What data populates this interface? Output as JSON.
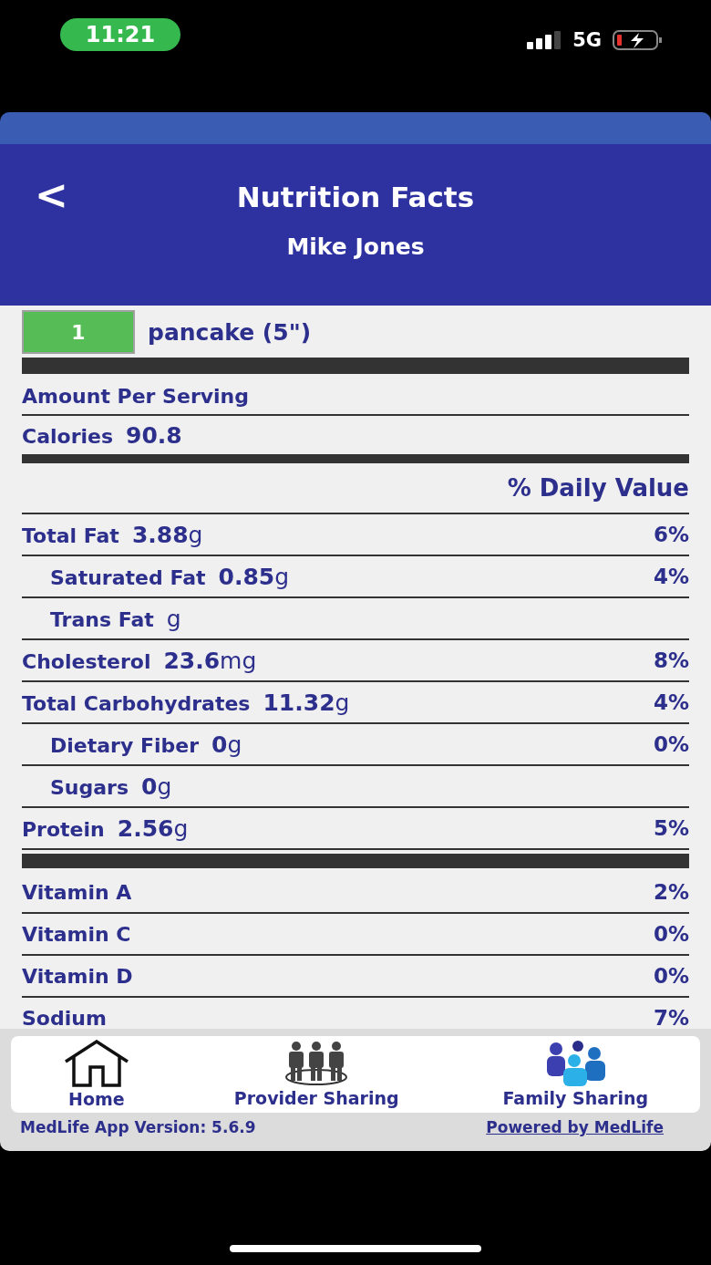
{
  "status_bar": {
    "time": "11:21",
    "network": "5G"
  },
  "header": {
    "back": "<",
    "title": "Nutrition Facts",
    "subtitle": "Mike Jones"
  },
  "serving": {
    "quantity": "1",
    "unit": "pancake (5\")"
  },
  "amount_label": "Amount Per Serving",
  "calories": {
    "label": "Calories",
    "value": "90.8"
  },
  "daily_value_header": "% Daily Value",
  "nutrients": [
    {
      "name": "Total Fat",
      "value": "3.88",
      "unit": "g",
      "percent": "6%",
      "children": [
        {
          "name": "Saturated Fat",
          "value": "0.85",
          "unit": "g",
          "percent": "4%"
        },
        {
          "name": "Trans Fat",
          "unit": "g"
        }
      ]
    },
    {
      "name": "Cholesterol",
      "value": "23.6",
      "unit": "mg",
      "percent": "8%"
    },
    {
      "name": "Total Carbohydrates",
      "value": "11.32",
      "unit": "g",
      "percent": "4%",
      "children": [
        {
          "name": "Dietary Fiber",
          "value": "0",
          "unit": "g",
          "percent": "0%"
        },
        {
          "name": "Sugars",
          "value": "0",
          "unit": "g"
        }
      ]
    },
    {
      "name": "Protein",
      "value": "2.56",
      "unit": "g",
      "percent": "5%"
    }
  ],
  "vitamins": [
    {
      "name": "Vitamin A",
      "percent": "2%"
    },
    {
      "name": "Vitamin C",
      "percent": "0%"
    },
    {
      "name": "Vitamin D",
      "percent": "0%"
    },
    {
      "name": "Sodium",
      "percent": "7%"
    }
  ],
  "tab_bar": [
    {
      "kind": "home",
      "label": "Home"
    },
    {
      "kind": "provider",
      "label": "Provider Sharing"
    },
    {
      "kind": "family",
      "label": "Family Sharing"
    }
  ],
  "footer": {
    "version": "MedLife App Version: 5.6.9",
    "link": "Powered by MedLife"
  }
}
